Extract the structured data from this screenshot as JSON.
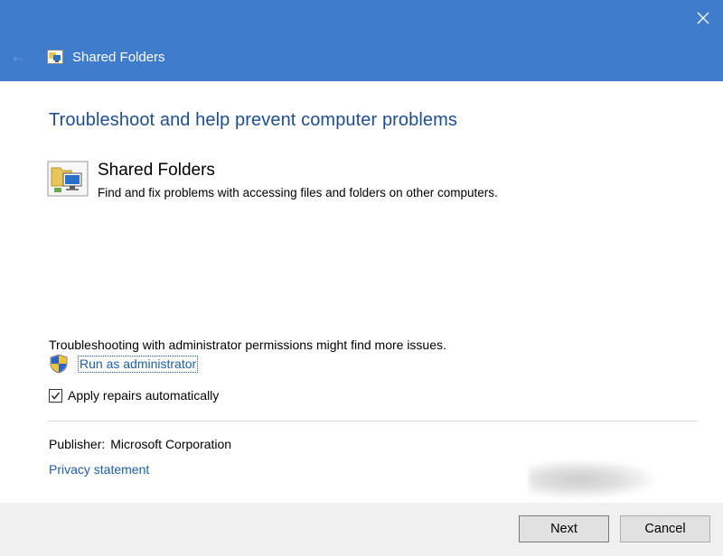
{
  "window": {
    "title": "Shared Folders",
    "back_icon": "back-arrow-icon",
    "close_icon": "close-icon",
    "title_color": "#3f7dcc"
  },
  "main": {
    "heading": "Troubleshoot and help prevent computer problems",
    "item": {
      "title": "Shared Folders",
      "description": "Find and fix problems with accessing files and folders on other computers.",
      "icon": "shared-folders-icon"
    },
    "admin_note": "Troubleshooting with administrator permissions might find more issues.",
    "run_as_admin_label": "Run as administrator",
    "apply_repairs": {
      "label": "Apply repairs automatically",
      "checked": true
    },
    "publisher_label": "Publisher:",
    "publisher_value": "Microsoft Corporation",
    "privacy_link": "Privacy statement"
  },
  "footer": {
    "next_label": "Next",
    "cancel_label": "Cancel"
  }
}
